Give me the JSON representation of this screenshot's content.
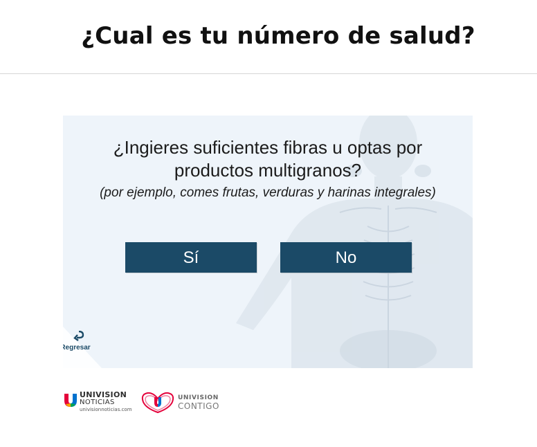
{
  "header": {
    "title": "¿Cual es tu número de salud?"
  },
  "question": {
    "text": "¿Ingieres suficientes fibras u optas por productos multigranos?",
    "hint": "(por ejemplo, comes frutas, verduras y harinas integrales)"
  },
  "answers": {
    "yes_label": "Sí",
    "no_label": "No"
  },
  "back": {
    "label": "Regresar",
    "icon": "back-arrow-icon"
  },
  "logos": {
    "noticias": {
      "word": "UNIVISION",
      "sub": "NOTICIAS",
      "url": "univisionnoticias.com"
    },
    "contigo": {
      "word": "UNIVISION",
      "sub": "CONTIGO"
    }
  },
  "colors": {
    "button": "#1b4a67",
    "panel": "#eef4fa",
    "divider": "#d6d6d6",
    "text": "#1b1b1b"
  }
}
